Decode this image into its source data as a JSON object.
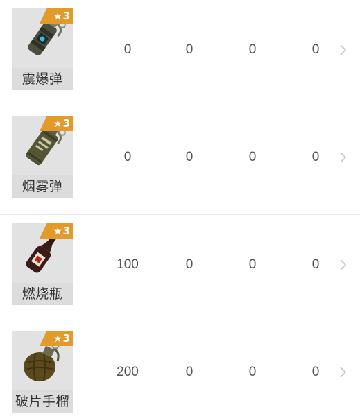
{
  "items": [
    {
      "name": "震爆弹",
      "rank": "3",
      "values": [
        "0",
        "0",
        "0",
        "0"
      ],
      "icon": "stun-grenade-icon"
    },
    {
      "name": "烟雾弹",
      "rank": "3",
      "values": [
        "0",
        "0",
        "0",
        "0"
      ],
      "icon": "smoke-grenade-icon"
    },
    {
      "name": "燃烧瓶",
      "rank": "3",
      "values": [
        "100",
        "0",
        "0",
        "0"
      ],
      "icon": "molotov-icon"
    },
    {
      "name": "破片手榴",
      "rank": "3",
      "values": [
        "200",
        "0",
        "0",
        "0"
      ],
      "icon": "frag-grenade-icon"
    }
  ],
  "rank_badge_icon": "star-icon",
  "row_action_icon": "chevron-right-icon",
  "colors": {
    "rank_badge": "#e29a2b",
    "card_bg": "#e2e2e2",
    "value_text": "#555555",
    "divider": "#e9e9e9"
  }
}
